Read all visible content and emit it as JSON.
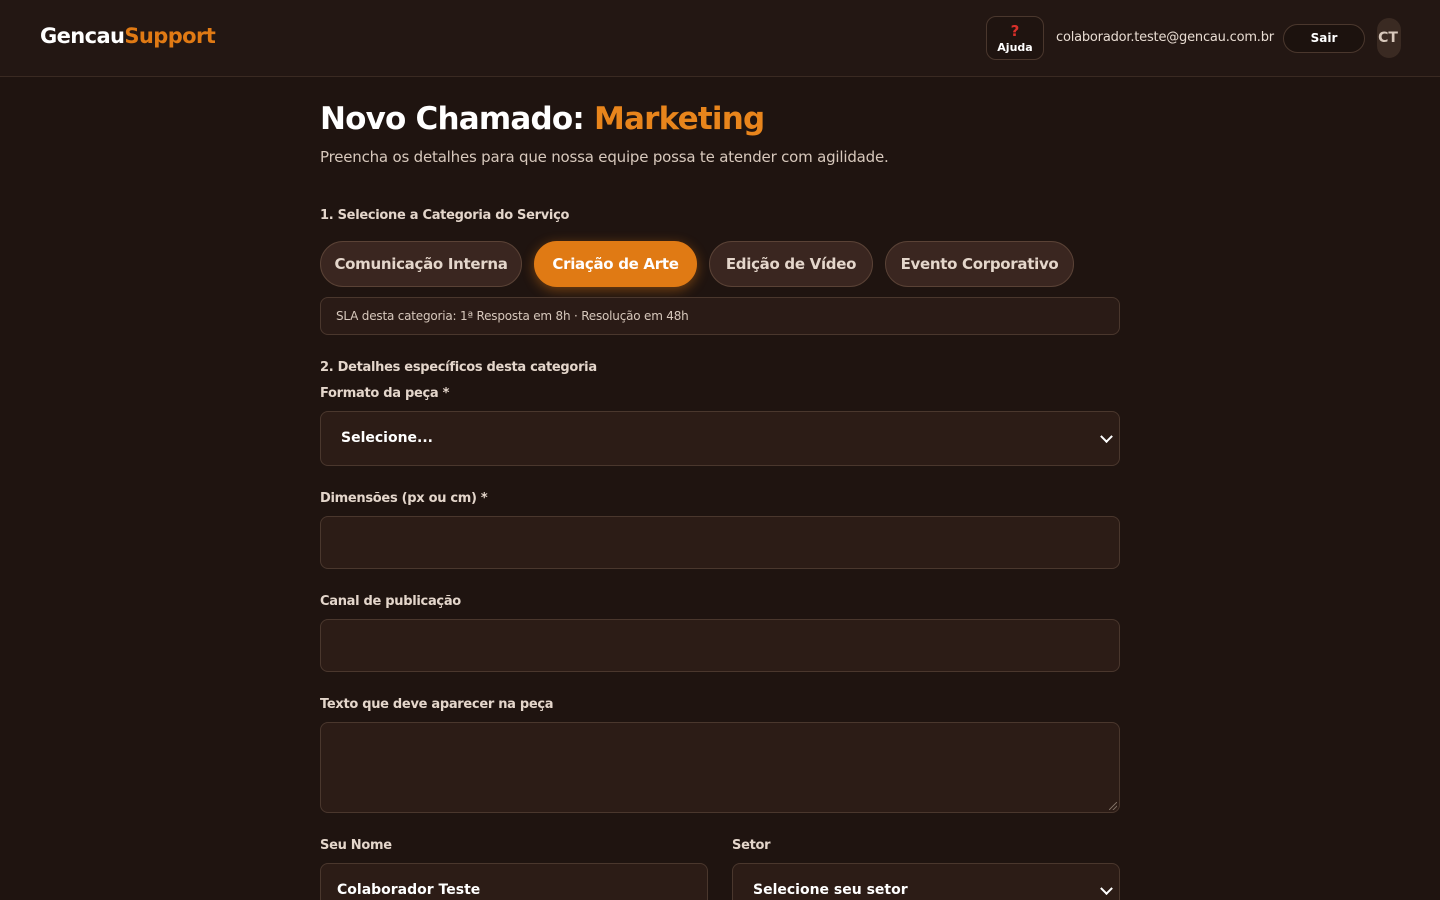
{
  "header": {
    "logo_part1": "Gencau",
    "logo_part2": "Support",
    "help_icon": "?",
    "help_label": "Ajuda",
    "user_email": "colaborador.teste@gencau.com.br",
    "logout_label": "Sair",
    "avatar_initials": "CT"
  },
  "page": {
    "title_prefix": "Novo Chamado: ",
    "title_accent": "Marketing",
    "subtitle": "Preencha os detalhes para que nossa equipe possa te atender com agilidade."
  },
  "categories": {
    "section_label": "1. Selecione a Categoria do Serviço",
    "items": [
      {
        "label": "Comunicação Interna",
        "active": false
      },
      {
        "label": "Criação de Arte",
        "active": true
      },
      {
        "label": "Edição de Vídeo",
        "active": false
      },
      {
        "label": "Evento Corporativo",
        "active": false
      }
    ],
    "sla_text": "SLA desta categoria: 1ª Resposta em 8h · Resolução em 48h"
  },
  "details": {
    "section_label": "2. Detalhes específicos desta categoria",
    "formato_label": "Formato da peça *",
    "formato_value": "Selecione...",
    "dimensoes_label": "Dimensões (px ou cm) *",
    "dimensoes_value": "",
    "canal_label": "Canal de publicação",
    "canal_value": "",
    "texto_label": "Texto que deve aparecer na peça",
    "texto_value": ""
  },
  "requester": {
    "name_label": "Seu Nome",
    "name_value": "Colaborador Teste",
    "setor_label": "Setor",
    "setor_value": "Selecione seu setor"
  },
  "colors": {
    "accent": "#e07a14",
    "background": "#1f1410",
    "help_icon": "#d9302a"
  },
  "icons": [
    "question-icon",
    "chevron-down-icon",
    "resize-handle-icon"
  ]
}
